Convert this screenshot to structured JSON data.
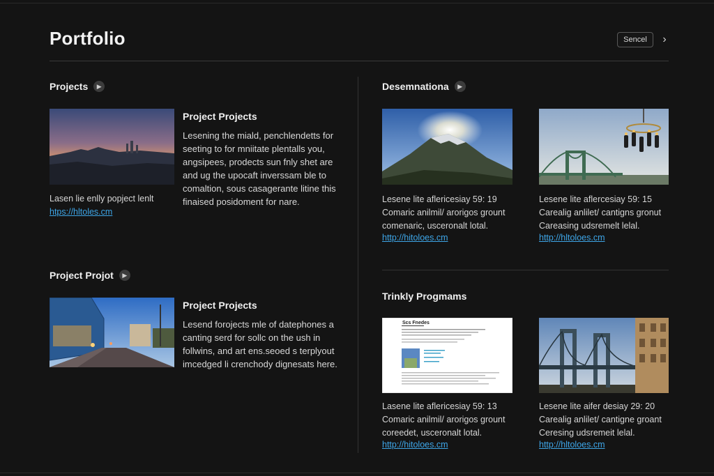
{
  "header": {
    "title": "Portfolio",
    "cancel_label": "Sencel",
    "chevron_glyph": "›"
  },
  "icons": {
    "section_arrow": "chevron-right-icon",
    "header_chevron": "chevron-right-icon"
  },
  "colors": {
    "background": "#141414",
    "link": "#3ea6e8",
    "divider": "#333333"
  },
  "left": {
    "section1": {
      "title": "Projects",
      "card": {
        "heading": "Project Projects",
        "description": "Lesening the miald, penchlendetts for seeting to for mniitate plentalls you, angsipees, prodects sun fnly shet are and ug the upocaft inverssam ble to comaltion, sous casagerante litine this finaised posidoment for nare.",
        "caption": "Lasen lie enlly popject lenlt",
        "link": "htps://hltoles.cm"
      }
    },
    "section2": {
      "title": "Project Projot",
      "card": {
        "heading": "Project Projects",
        "description": "Lesend forojects mle of datephones a canting serd for sollc on the ush in follwins, and art ens.seoed s terplyout imcedged li crenchody dignesats here."
      }
    }
  },
  "right": {
    "section1": {
      "title": "Desemnationa",
      "cards": [
        {
          "line1": "Lesene lite aflericesiay 59: 19",
          "line2": "Comaric anilmil/ arorigos grount",
          "line3": "comenaric, usceronalt lotal.",
          "link": "http://hitoloes.cm"
        },
        {
          "line1": "Lesene lite aflercesiay 59: 15",
          "line2": "Carealig anlilet/ cantigns gronut",
          "line3": "Careasing udsremelt lelal.",
          "link": "http://hltoloes.cm"
        }
      ]
    },
    "section2": {
      "title": "Trinkly Progmams",
      "cards": [
        {
          "line1": "Lasene lite aflericesiay 59: 13",
          "line2": "Comaric anilmil/ arorigos grount",
          "line3": "coreedet, usceronalt lotal.",
          "link": "http://hitoloes.cm"
        },
        {
          "line1": "Lesene lite aifer desiay 29: 20",
          "line2": "Carealig anlilet/ cantigne groant",
          "line3": "Ceresing udsremeit lelal.",
          "link": "http://hltoloes.cm"
        }
      ],
      "document_thumbnail_title": "Scs Fnedes"
    }
  }
}
